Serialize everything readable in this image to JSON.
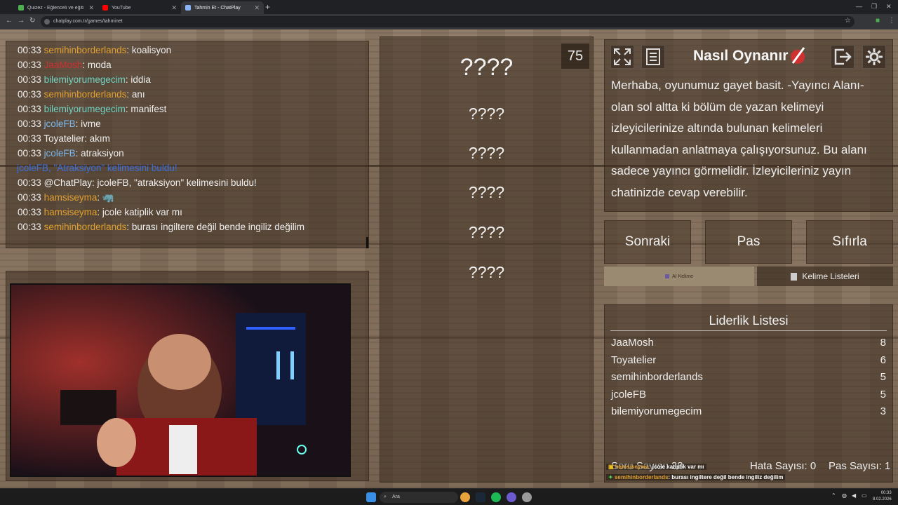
{
  "browser": {
    "tabs": [
      {
        "title": "Quizez - Eğlenceli ve eğitileyici",
        "fav_color": "#4caf50"
      },
      {
        "title": "YouTube",
        "fav_color": "#ff0000"
      },
      {
        "title": "Tahmin Et - ChatPlay",
        "fav_color": "#8ab4f8"
      }
    ],
    "url": "chatplay.com.tr/games/tahminet"
  },
  "chat": {
    "lines": [
      {
        "time": "00:33",
        "user": "semihinborderlands",
        "user_class": "c-orange",
        "msg": ": koalisyon"
      },
      {
        "time": "00:33",
        "user": "JaaMosh",
        "user_class": "c-red",
        "msg": ": moda"
      },
      {
        "time": "00:33",
        "user": "bilemiyorumegecim",
        "user_class": "c-teal",
        "msg": ": iddia"
      },
      {
        "time": "00:33",
        "user": "semihinborderlands",
        "user_class": "c-orange",
        "msg": ": anı"
      },
      {
        "time": "00:33",
        "user": "bilemiyorumegecim",
        "user_class": "c-teal",
        "msg": ": manifest"
      },
      {
        "time": "00:33",
        "user": "jcoleFB",
        "user_class": "c-sky",
        "msg": ": ivme"
      },
      {
        "time": "00:33",
        "user": "Toyatelier",
        "user_class": "c-white",
        "msg": ": akım"
      },
      {
        "time": "00:33",
        "user": "jcoleFB",
        "user_class": "c-sky",
        "msg": ": atraksiyon"
      }
    ],
    "found_notice": "jcoleFB, \"Atraksiyon\" kelimesini buldu!",
    "lines2": [
      {
        "time": "00:33",
        "user": "@ChatPlay",
        "user_class": "c-white",
        "msg": ": jcoleFB, \"atraksiyon\" kelimesini buldu!"
      },
      {
        "time": "00:33",
        "user": "hamsiseyma",
        "user_class": "c-orange",
        "msg": ": 🦏"
      },
      {
        "time": "00:33",
        "user": "hamsiseyma",
        "user_class": "c-orange",
        "msg": ": jcole katiplik var mı"
      },
      {
        "time": "00:33",
        "user": "semihinborderlands",
        "user_class": "c-orange",
        "msg": ": burası ingiltere değil bende ingiliz değilim"
      }
    ]
  },
  "words": {
    "main": "????",
    "others": [
      "????",
      "????",
      "????",
      "????",
      "????"
    ],
    "timer": "75"
  },
  "howto": {
    "title": "Nasıl Oynanır",
    "text": "Merhaba, oyunumuz gayet basit. -Yayıncı Alanı- olan sol altta ki bölüm de yazan kelimeyi izleyicilerinize altında bulunan kelimeleri kullanmadan anlatmaya çalışıyorsunuz. Bu alanı sadece yayıncı görmelidir. İzleyicileriniz yayın chatinizde cevap verebilir."
  },
  "actions": {
    "next": "Sonraki",
    "pass": "Pas",
    "reset": "Sıfırla",
    "ai_word": "AI Kelime",
    "word_lists": "Kelime Listeleri"
  },
  "leaderboard": {
    "title": "Liderlik Listesi",
    "rows": [
      {
        "name": "JaaMosh",
        "score": "8"
      },
      {
        "name": "Toyatelier",
        "score": "6"
      },
      {
        "name": "semihinborderlands",
        "score": "5"
      },
      {
        "name": "jcoleFB",
        "score": "5"
      },
      {
        "name": "bilemiyorumegecim",
        "score": "3"
      }
    ]
  },
  "stats": {
    "question_count": "Soru Sayısı: 28",
    "error_count": "Hata Sayısı: 0",
    "pass_count": "Pas Sayısı: 1"
  },
  "overlay_chat": [
    {
      "user": "hamsiseyma",
      "msg": ": jcole katiplik var mı"
    },
    {
      "user": "semihinborderlands",
      "msg": ": burası ingiltere değil bende ingiliz değilim"
    }
  ],
  "taskbar": {
    "search": "Ara",
    "time": "00:33",
    "date": "8.02.2026"
  }
}
